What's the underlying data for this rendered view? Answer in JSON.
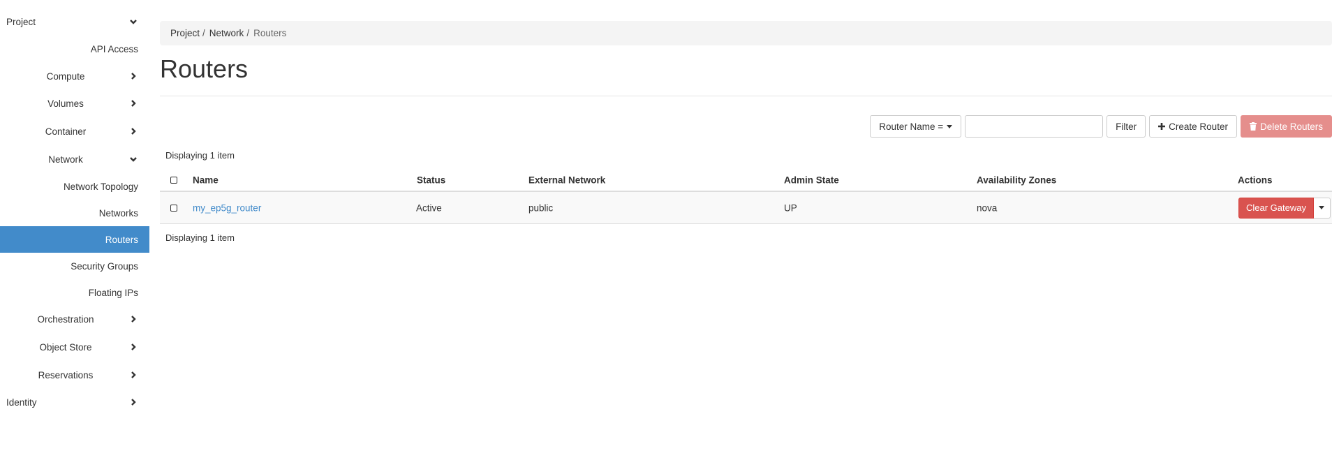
{
  "sidebar": {
    "items": [
      {
        "label": "Project",
        "icon": "chevron-down-icon"
      },
      {
        "label": "API Access"
      },
      {
        "label": "Compute",
        "icon": "chevron-right-icon"
      },
      {
        "label": "Volumes",
        "icon": "chevron-right-icon"
      },
      {
        "label": "Container",
        "icon": "chevron-right-icon"
      },
      {
        "label": "Network",
        "icon": "chevron-down-icon"
      },
      {
        "label": "Network Topology"
      },
      {
        "label": "Networks"
      },
      {
        "label": "Routers",
        "active": true
      },
      {
        "label": "Security Groups"
      },
      {
        "label": "Floating IPs"
      },
      {
        "label": "Orchestration",
        "icon": "chevron-right-icon"
      },
      {
        "label": "Object Store",
        "icon": "chevron-right-icon"
      },
      {
        "label": "Reservations",
        "icon": "chevron-right-icon"
      },
      {
        "label": "Identity",
        "icon": "chevron-right-icon"
      }
    ]
  },
  "breadcrumb": [
    "Project",
    "Network",
    "Routers"
  ],
  "breadcrumb_sep": "/",
  "page_title": "Routers",
  "toolbar": {
    "filter_field": "Router Name =",
    "filter_value": "",
    "filter_label": "Filter",
    "create_label": "Create Router",
    "delete_label": "Delete Routers"
  },
  "display_count_top": "Displaying 1 item",
  "display_count_bottom": "Displaying 1 item",
  "table": {
    "columns": [
      "Name",
      "Status",
      "External Network",
      "Admin State",
      "Availability Zones",
      "Actions"
    ],
    "rows": [
      {
        "name": "my_ep5g_router",
        "status": "Active",
        "external_network": "public",
        "admin_state": "UP",
        "availability_zones": "nova",
        "action": "Clear Gateway"
      }
    ]
  },
  "colors": {
    "active_nav": "#428bca",
    "link": "#428bca",
    "danger": "#d9534f",
    "danger_disabled": "#e58e8c"
  }
}
